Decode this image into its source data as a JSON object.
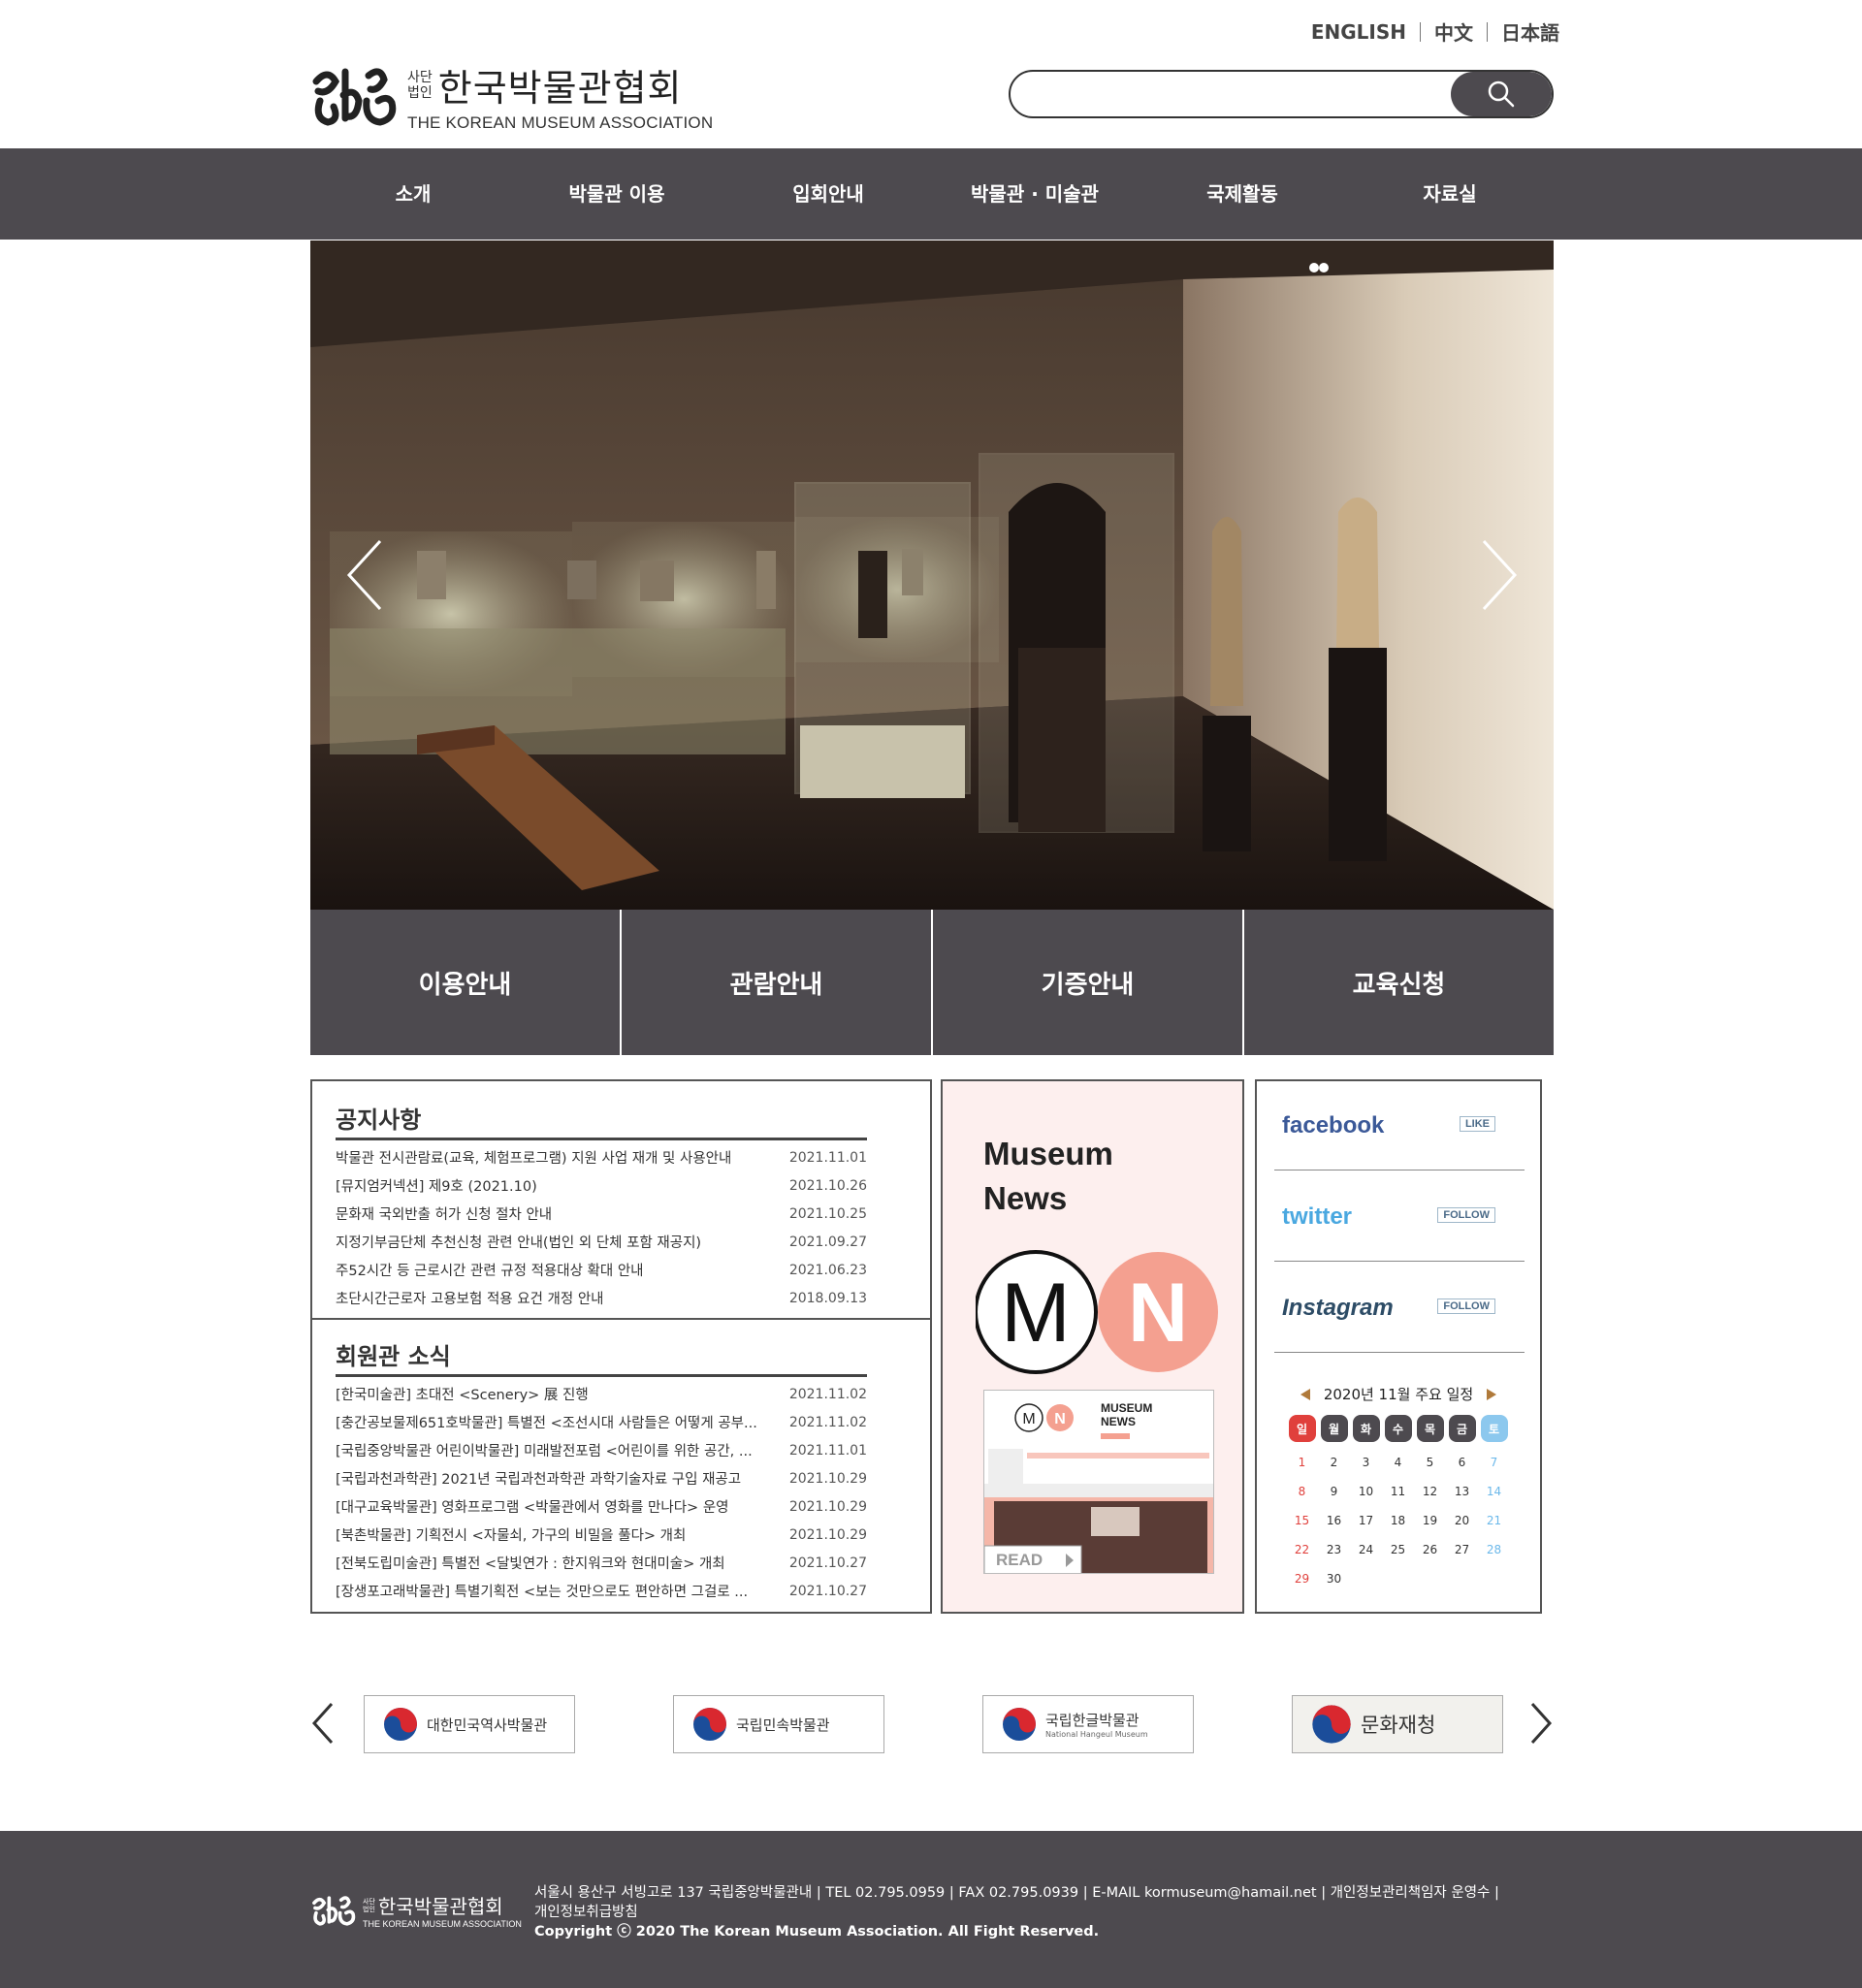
{
  "header": {
    "languages": [
      "ENGLISH",
      "中文",
      "日本語"
    ],
    "logo": {
      "small_top": "사단",
      "small_bottom": "법인",
      "title": "한국박물관협회",
      "subtitle": "THE KOREAN MUSEUM ASSOCIATION"
    },
    "search": {
      "placeholder": "",
      "value": ""
    }
  },
  "nav": [
    "소개",
    "박물관 이용",
    "입회안내",
    "박물관 · 미술관",
    "국제활동",
    "자료실"
  ],
  "quick_links": [
    "이용안내",
    "관람안내",
    "기증안내",
    "교육신청"
  ],
  "notice": {
    "title": "공지사항",
    "items": [
      {
        "title": "박물관 전시관람료(교육, 체험프로그램) 지원 사업 재개 및 사용안내",
        "date": "2021.11.01"
      },
      {
        "title": "[뮤지엄커넥션] 제9호 (2021.10)",
        "date": "2021.10.26"
      },
      {
        "title": "문화재 국외반출 허가 신청 절차 안내",
        "date": "2021.10.25"
      },
      {
        "title": "지정기부금단체 추천신청 관련 안내(법인 외 단체 포함 재공지)",
        "date": "2021.09.27"
      },
      {
        "title": "주52시간 등 근로시간 관련 규정 적용대상 확대 안내",
        "date": "2021.06.23"
      },
      {
        "title": "초단시간근로자 고용보험 적용 요건 개정 안내",
        "date": "2018.09.13"
      }
    ]
  },
  "members": {
    "title": "회원관 소식",
    "items": [
      {
        "title": "[한국미술관] 초대전 <Scenery> 展 진행",
        "date": "2021.11.02"
      },
      {
        "title": "[충간공보물제651호박물관] 특별전 <조선시대 사람들은 어떻게 공부...",
        "date": "2021.11.02"
      },
      {
        "title": "[국립중앙박물관 어린이박물관] 미래발전포럼 <어린이를 위한 공간, ...",
        "date": "2021.11.01"
      },
      {
        "title": "[국립과천과학관] 2021년 국립과천과학관 과학기술자료 구입 재공고",
        "date": "2021.10.29"
      },
      {
        "title": "[대구교육박물관] 영화프로그램 <박물관에서 영화를 만나다> 운영",
        "date": "2021.10.29"
      },
      {
        "title": "[북촌박물관] 기획전시 <자물쇠, 가구의 비밀을 풀다> 개최",
        "date": "2021.10.29"
      },
      {
        "title": "[전북도립미술관] 특별전 <달빛연가 : 한지워크와 현대미술> 개최",
        "date": "2021.10.27"
      },
      {
        "title": "[장생포고래박물관] 특별기획전 <보는 것만으로도 편안하면 그걸로 ...",
        "date": "2021.10.27"
      }
    ]
  },
  "museum_news": {
    "title": "Museum\nNews",
    "logo_letters": [
      "M",
      "N"
    ],
    "card": {
      "heading": "MUSEUM NEWS",
      "read_label": "READ"
    }
  },
  "social": [
    {
      "name": "facebook",
      "action": "LIKE",
      "color": "#3b5998",
      "icon": "facebook-icon"
    },
    {
      "name": "twitter",
      "action": "FOLLOW",
      "color": "#4aa8e0",
      "icon": "twitter-icon"
    },
    {
      "name": "Instagram",
      "action": "FOLLOW",
      "color": "#2d4c66",
      "icon": "instagram-icon"
    }
  ],
  "calendar": {
    "title": "2020년 11월 주요 일정",
    "weekdays": [
      "일",
      "월",
      "화",
      "수",
      "목",
      "금",
      "토"
    ],
    "weekday_colors": [
      "#e0403c",
      "#4d4a4f",
      "#4d4a4f",
      "#4d4a4f",
      "#4d4a4f",
      "#4d4a4f",
      "#8cc8ee"
    ],
    "weeks": [
      [
        "1",
        "2",
        "3",
        "4",
        "5",
        "6",
        "7"
      ],
      [
        "8",
        "9",
        "10",
        "11",
        "12",
        "13",
        "14"
      ],
      [
        "15",
        "16",
        "17",
        "18",
        "19",
        "20",
        "21"
      ],
      [
        "22",
        "23",
        "24",
        "25",
        "26",
        "27",
        "28"
      ],
      [
        "29",
        "30",
        "",
        "",
        "",
        "",
        ""
      ]
    ]
  },
  "partners": [
    {
      "name": "대한민국역사박물관",
      "sub": ""
    },
    {
      "name": "국립민속박물관",
      "sub": ""
    },
    {
      "name": "국립한글박물관",
      "sub": "National Hangeul Museum"
    },
    {
      "name": "문화재청",
      "sub": ""
    }
  ],
  "footer": {
    "address_line": "서울시 용산구 서빙고로 137 국립중앙박물관내  |  TEL 02.795.0959  |  FAX 02.795.0939  |  E-MAIL kormuseum@hamail.net  |  개인정보관리책임자 운영수  |",
    "policy": "개인정보취급방침",
    "copyright": "Copyright ⓒ 2020 The Korean Museum Association. All Fight Reserved."
  },
  "colors": {
    "nav_bg": "#4d4a4f",
    "news_bg": "#fdefee",
    "accent_pink": "#f4a090"
  }
}
